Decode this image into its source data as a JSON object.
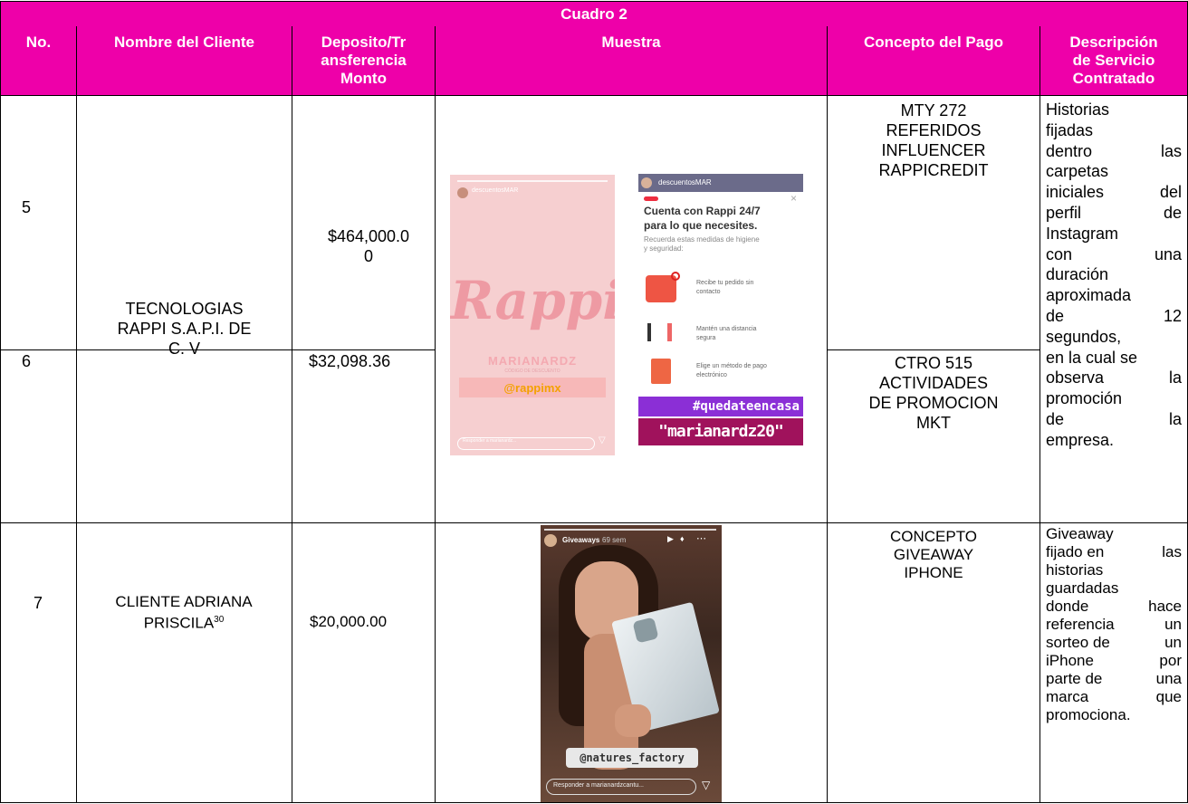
{
  "title": "Cuadro 2",
  "headers": {
    "no": "No.",
    "client": "Nombre del Cliente",
    "amount": [
      "Deposito/Tr",
      "ansferencia",
      "Monto"
    ],
    "sample": "Muestra",
    "concept": "Concepto del Pago",
    "description": [
      "Descripción",
      "de Servicio",
      "Contratado"
    ]
  },
  "rows": [
    {
      "no": "5",
      "amount": [
        "$464,000.0",
        "0"
      ],
      "concept": [
        "MTY 272",
        "REFERIDOS",
        "INFLUENCER",
        "RAPPICREDIT"
      ]
    },
    {
      "no": "6",
      "amount": [
        "$32,098.36"
      ],
      "concept": [
        "CTRO 515",
        "ACTIVIDADES",
        "DE PROMOCION",
        "MKT"
      ]
    },
    {
      "no": "7",
      "amount": [
        "$20,000.00"
      ],
      "concept": [
        "CONCEPTO",
        "GIVEAWAY",
        "IPHONE"
      ]
    }
  ],
  "rappi_client": [
    "TECNOLOGIAS",
    "RAPPI S.A.P.I. DE",
    "C. V"
  ],
  "adriana_client": "CLIENTE ADRIANA PRISCILA",
  "adriana_footnote": "30",
  "rappi_description": [
    [
      "Historias"
    ],
    [
      "fijadas"
    ],
    [
      "dentro",
      "las"
    ],
    [
      "carpetas"
    ],
    [
      "iniciales",
      "del"
    ],
    [
      "perfil",
      "de"
    ],
    [
      "Instagram"
    ],
    [
      "con",
      "una"
    ],
    [
      "duración"
    ],
    [
      "aproximada"
    ],
    [
      "de",
      "12"
    ],
    [
      "segundos,"
    ],
    [
      "en la cual se"
    ],
    [
      "observa",
      "la"
    ],
    [
      "promoción"
    ],
    [
      "de",
      "la"
    ],
    [
      "empresa."
    ]
  ],
  "giveaway_description": [
    [
      "Giveaway"
    ],
    [
      "fijado en",
      "las"
    ],
    [
      "historias"
    ],
    [
      "guardadas"
    ],
    [
      "donde",
      "hace"
    ],
    [
      "referencia",
      "un"
    ],
    [
      "sorteo de",
      "un"
    ],
    [
      "iPhone",
      "por"
    ],
    [
      "parte de",
      "una"
    ],
    [
      "marca",
      "que"
    ],
    [
      "promociona."
    ]
  ],
  "story1": {
    "account": "descuentosMAR",
    "brand": "Rappi",
    "name": "MARIANARDZ",
    "sub": "CÓDIGO DE DESCUENTO",
    "handle": "@rappimx",
    "reply": "Responder a marianardz..."
  },
  "story2": {
    "account": "descuentosMAR",
    "heading1": "Cuenta con Rappi 24/7",
    "heading2": "para lo que necesites.",
    "intro": "Recuerda estas medidas de higiene y seguridad:",
    "tip1": "Recibe tu pedido sin contacto",
    "tip2": "Mantén una distancia segura",
    "tip3": "Elige un método de pago electrónico",
    "hashtag": "#quedateencasa",
    "code": "\"marianardz20\""
  },
  "story3": {
    "account": "Giveaways",
    "time": "69 sem",
    "handle": "@natures_factory",
    "reply": "Responder a marianardzcantu..."
  },
  "colors": {
    "header": "#ee00a9",
    "rappi_pink": "#f2c7c7",
    "code_bg": "#a0125c"
  }
}
